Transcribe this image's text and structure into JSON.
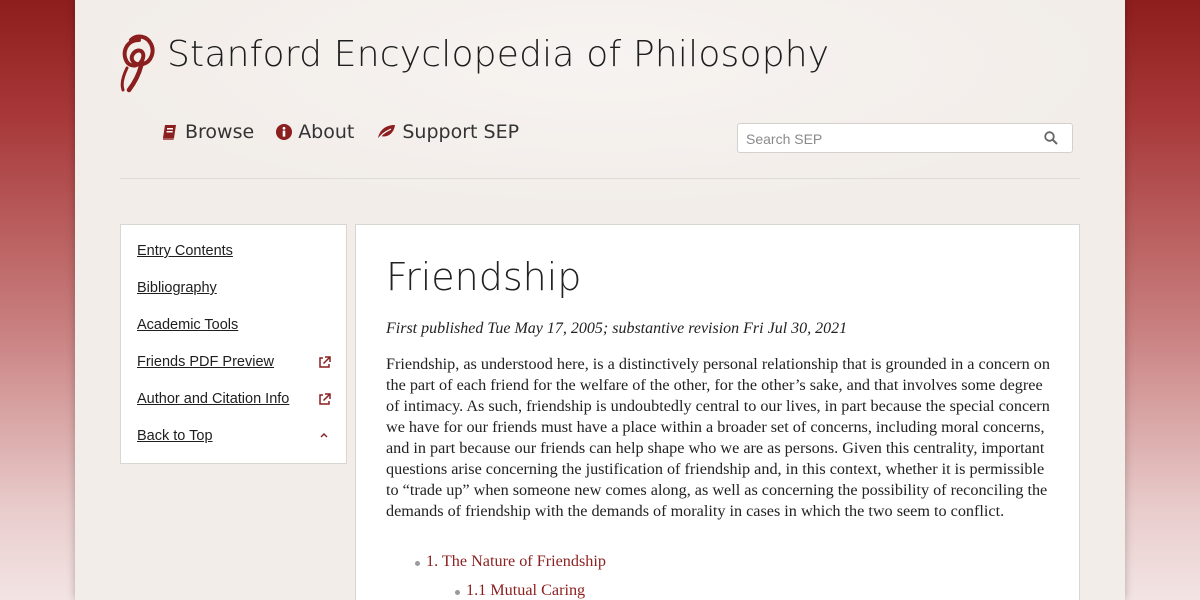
{
  "site": {
    "title": "Stanford Encyclopedia of Philosophy"
  },
  "nav": {
    "browse": "Browse",
    "about": "About",
    "support": "Support SEP"
  },
  "search": {
    "placeholder": "Search SEP",
    "value": ""
  },
  "sidebar": {
    "items": [
      {
        "label": "Entry Contents",
        "icon": ""
      },
      {
        "label": "Bibliography",
        "icon": ""
      },
      {
        "label": "Academic Tools",
        "icon": ""
      },
      {
        "label": "Friends PDF Preview",
        "icon": "external-link-icon"
      },
      {
        "label": "Author and Citation Info",
        "icon": "external-link-icon"
      },
      {
        "label": "Back to Top",
        "icon": "chevron-up-icon"
      }
    ]
  },
  "entry": {
    "title": "Friendship",
    "pubinfo": "First published Tue May 17, 2005; substantive revision Fri Jul 30, 2021",
    "preamble": "Friendship, as understood here, is a distinctively personal relationship that is grounded in a concern on the part of each friend for the welfare of the other, for the other’s sake, and that involves some degree of intimacy. As such, friendship is undoubtedly central to our lives, in part because the special concern we have for our friends must have a place within a broader set of concerns, including moral concerns, and in part because our friends can help shape who we are as persons. Given this centrality, important questions arise concerning the justification of friendship and, in this context, whether it is permissible to “trade up” when someone new comes along, as well as concerning the possibility of reconciling the demands of friendship with the demands of morality in cases in which the two seem to conflict.",
    "toc": [
      {
        "label": "1. The Nature of Friendship",
        "level": 1
      },
      {
        "label": "1.1 Mutual Caring",
        "level": 2
      }
    ]
  },
  "colors": {
    "accent": "#8b1e1e",
    "background_top": "#8e1d1d",
    "page": "#f2ede9"
  }
}
